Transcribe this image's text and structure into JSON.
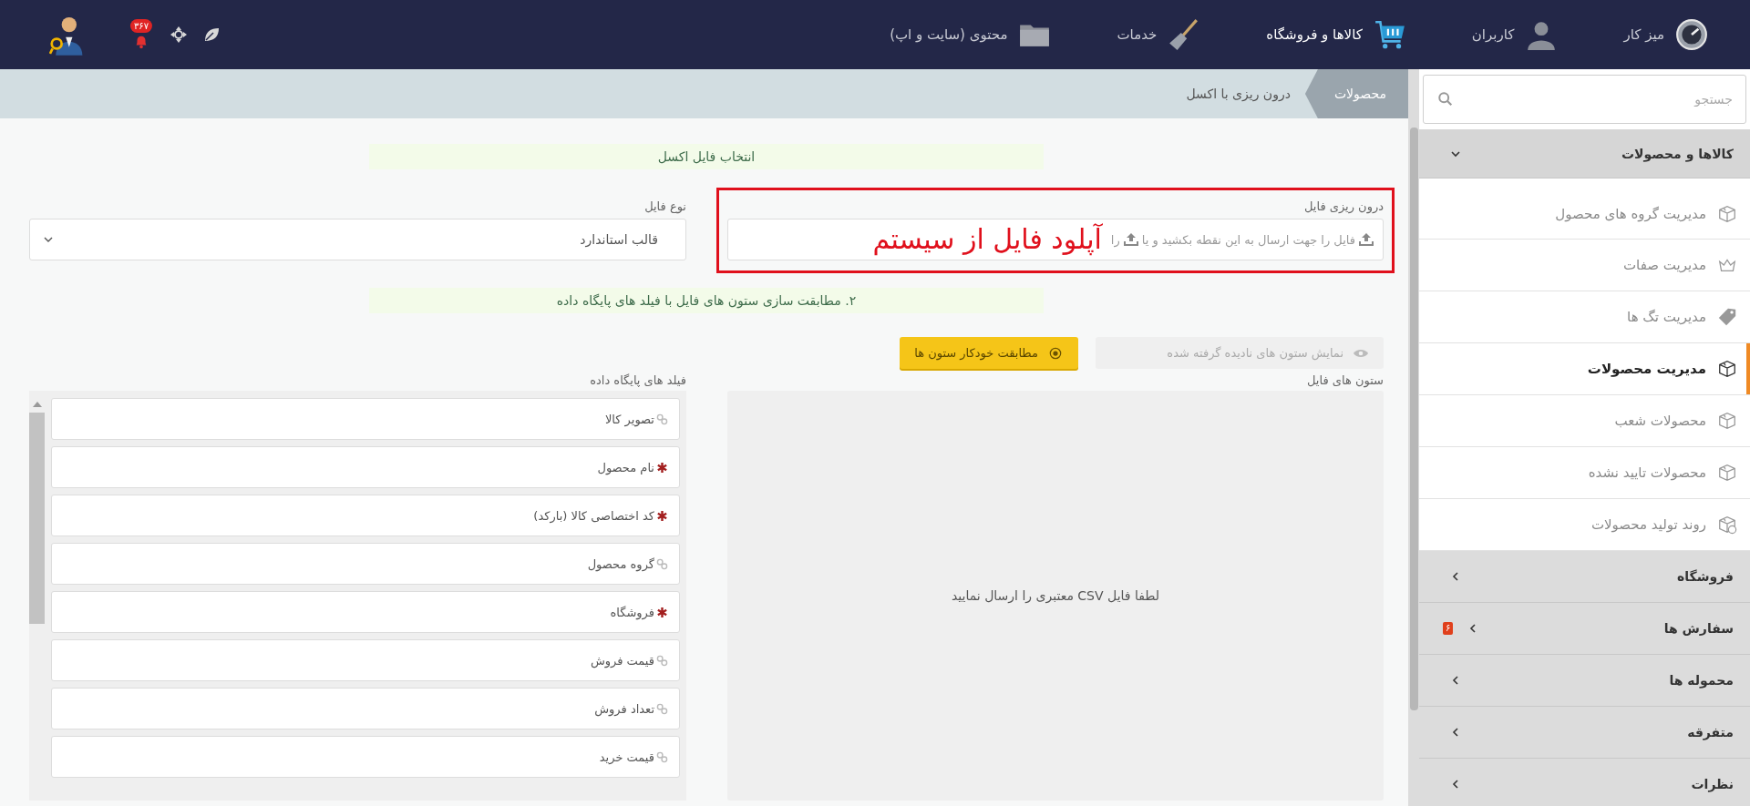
{
  "topbar": {
    "nav": [
      {
        "label": "میز کار",
        "selected": false
      },
      {
        "label": "کاربران",
        "selected": false
      },
      {
        "label": "کالاها و فروشگاه",
        "selected": true
      },
      {
        "label": "خدمات",
        "selected": false
      },
      {
        "label": "محتوی (سایت و اپ)",
        "selected": false
      }
    ],
    "notification_count": "۳۶۷"
  },
  "breadcrumb": [
    {
      "label": "محصولات",
      "current": false
    },
    {
      "label": "درون ریزی با اکسل",
      "current": true
    }
  ],
  "sidebar": {
    "search": {
      "placeholder": "جستجو"
    },
    "groups": [
      {
        "label": "کالاها و محصولات",
        "expanded": true,
        "children": [
          {
            "label": "مدیریت گروه های محصول",
            "selected": false
          },
          {
            "label": "مدیریت صفات",
            "selected": false
          },
          {
            "label": "مدیریت تگ ها",
            "selected": false
          },
          {
            "label": "مدیریت محصولات",
            "selected": true
          },
          {
            "label": "محصولات شعب",
            "selected": false
          },
          {
            "label": "محصولات تایید نشده",
            "selected": false
          },
          {
            "label": "روند تولید محصولات",
            "selected": false
          }
        ]
      },
      {
        "label": "فروشگاه",
        "expanded": false
      },
      {
        "label": "سفارش ها",
        "expanded": false,
        "badge": "۶"
      },
      {
        "label": "محموله ها",
        "expanded": false
      },
      {
        "label": "متفرقه",
        "expanded": false
      },
      {
        "label": "نظرات",
        "expanded": false
      }
    ]
  },
  "form": {
    "step1": "انتخاب فایل اکسل",
    "file_upload": {
      "label": "درون ریزی فایل",
      "hint_start": "فایل را جهت ارسال به این نقطه بکشید و یا",
      "hint_end": "را"
    },
    "file_type": {
      "label": "نوع فایل",
      "value": "قالب استاندارد"
    },
    "step2": "۲. مطابقت سازی ستون های فایل با فیلد های پایگاه داده",
    "buttons": [
      {
        "label": "نمایش ستون های نادیده گرفته شده",
        "kind": "secondary"
      },
      {
        "label": "مطابقت خودکار ستون ها",
        "kind": "primary"
      }
    ],
    "file_columns": {
      "label": "ستون های فایل",
      "empty_message": "لطفا فایل CSV معتبری را ارسال نمایید"
    },
    "db_fields": {
      "label": "فیلد های پایگاه داده",
      "fields": [
        {
          "label": "تصویر کالا",
          "required": false
        },
        {
          "label": "نام محصول",
          "required": true
        },
        {
          "label": "کد اختصاصی کالا (بارکد)",
          "required": true
        },
        {
          "label": "گروه محصول",
          "required": false
        },
        {
          "label": "فروشگاه",
          "required": true
        },
        {
          "label": "قیمت فروش",
          "required": false
        },
        {
          "label": "تعداد فروش",
          "required": false
        },
        {
          "label": "قیمت خرید",
          "required": false
        }
      ]
    }
  },
  "annotation": {
    "text": "آپلود فایل از سیستم"
  }
}
